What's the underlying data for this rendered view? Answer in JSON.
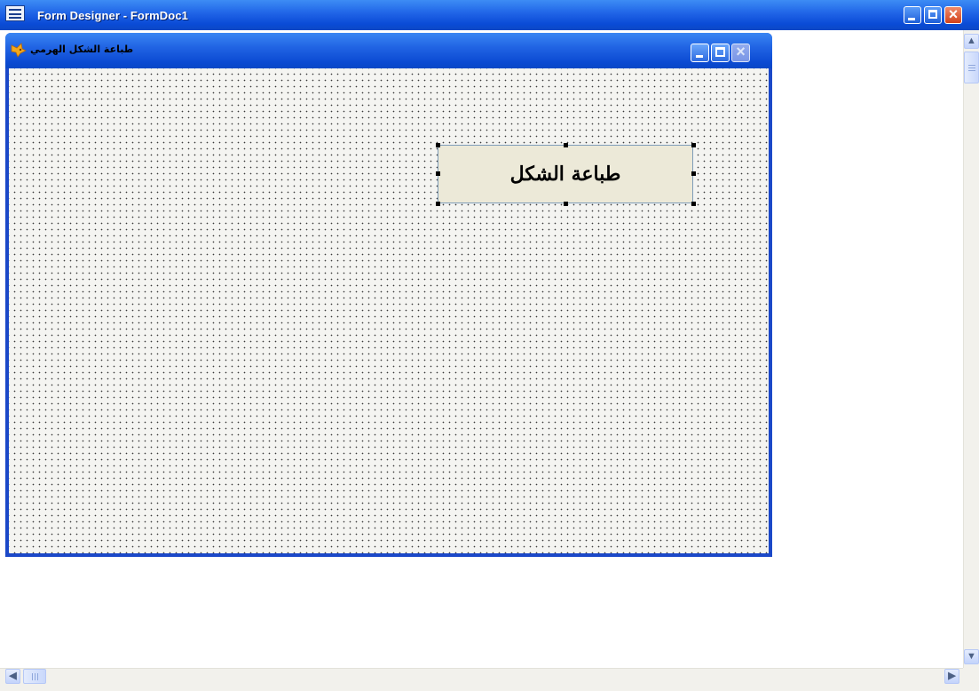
{
  "outer_window": {
    "title": "Form Designer - FormDoc1",
    "icon": "form-designer-icon",
    "buttons": [
      "minimize-icon",
      "maximize-icon",
      "close-icon"
    ]
  },
  "form": {
    "title": "طباعة الشكل الهرمي",
    "icon": "foxpro-icon",
    "buttons": [
      "minimize-icon",
      "maximize-icon",
      "close-icon"
    ],
    "close_disabled": true
  },
  "design_button": {
    "caption": "طباعة الشكل"
  },
  "scrollbars": {
    "vertical": {
      "up": "▲",
      "down": "▼"
    },
    "horizontal": {
      "left": "◀",
      "right": "▶"
    }
  },
  "colors": {
    "titlebar": "#0a49d1",
    "canvas": "#f4f4f1",
    "grid_dot": "#3a3a3a",
    "button_face": "#ece9d8"
  }
}
